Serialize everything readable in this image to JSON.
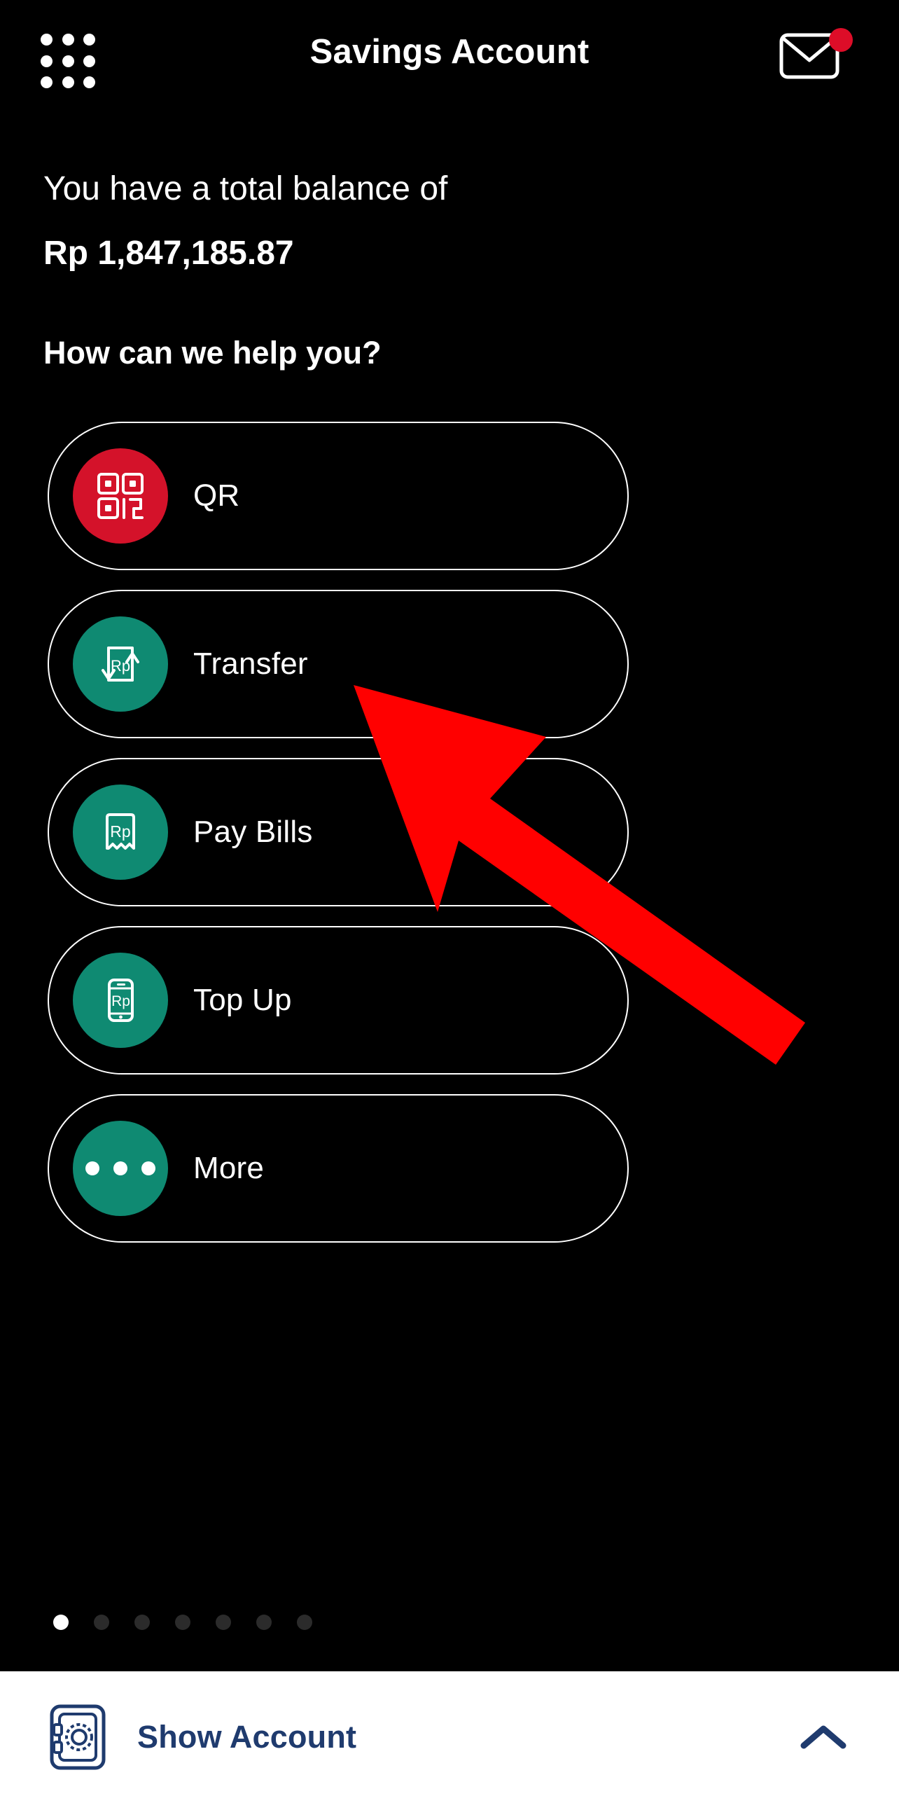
{
  "header": {
    "title": "Savings Account",
    "menu_icon": "grid-dots-icon",
    "mail_icon": "envelope-icon",
    "mail_badge": "unread-indicator"
  },
  "balance": {
    "label": "You have a total balance of",
    "amount": "Rp 1,847,185.87"
  },
  "help": {
    "title": "How can we help you?"
  },
  "actions": [
    {
      "label": "QR",
      "icon": "qr-code-icon",
      "circle_color": "#d4122a"
    },
    {
      "label": "Transfer",
      "icon": "transfer-rp-icon",
      "circle_color": "#0f8a72"
    },
    {
      "label": "Pay Bills",
      "icon": "receipt-rp-icon",
      "circle_color": "#0f8a72"
    },
    {
      "label": "Top Up",
      "icon": "phone-rp-icon",
      "circle_color": "#0f8a72"
    },
    {
      "label": "More",
      "icon": "ellipsis-icon",
      "circle_color": "#0f8a72"
    }
  ],
  "pagination": {
    "total": 7,
    "active_index": 1
  },
  "bottom_sheet": {
    "label": "Show Account",
    "icon": "safe-vault-icon",
    "expand_icon": "chevron-up-icon"
  },
  "annotation": {
    "type": "arrow",
    "color": "#ff0000",
    "points_to": "Transfer"
  },
  "colors": {
    "background": "#000000",
    "accent_red": "#d4122a",
    "accent_teal": "#0f8a72",
    "navy": "#1f3b6e",
    "text": "#ffffff"
  }
}
